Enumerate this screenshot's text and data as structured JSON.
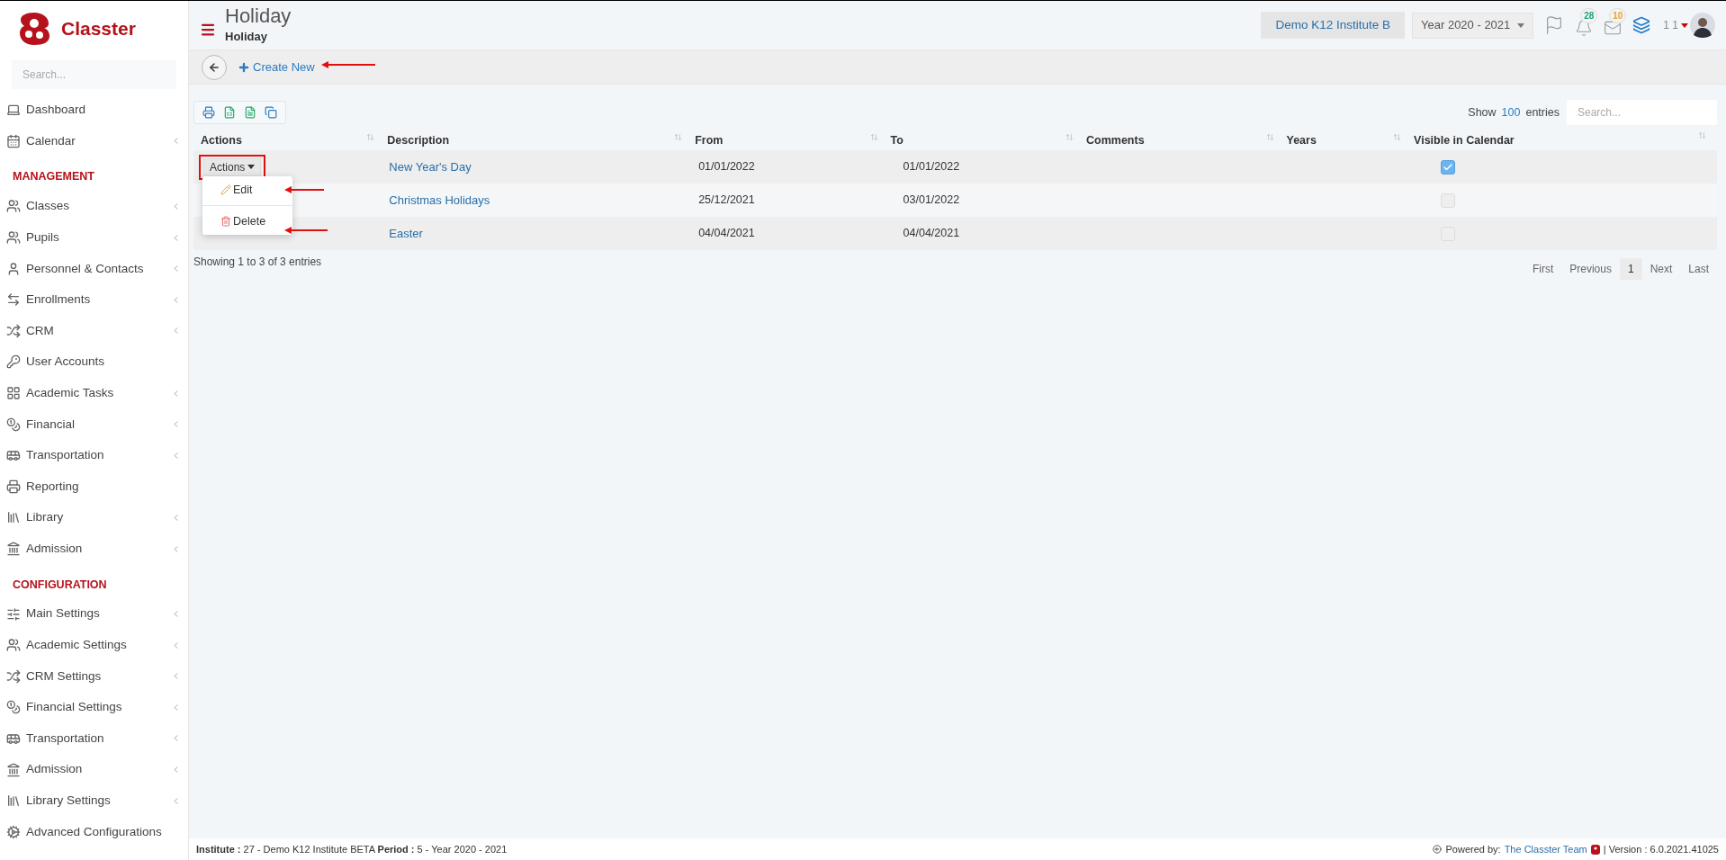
{
  "brand": {
    "name": "Classter"
  },
  "sidebar": {
    "search_placeholder": "Search...",
    "items": [
      {
        "kind": "item",
        "label": "Dashboard",
        "submenu": false
      },
      {
        "kind": "item",
        "label": "Calendar",
        "submenu": true
      },
      {
        "kind": "section",
        "label": "MANAGEMENT"
      },
      {
        "kind": "item",
        "label": "Classes",
        "submenu": true
      },
      {
        "kind": "item",
        "label": "Pupils",
        "submenu": true
      },
      {
        "kind": "item",
        "label": "Personnel & Contacts",
        "submenu": true
      },
      {
        "kind": "item",
        "label": "Enrollments",
        "submenu": true
      },
      {
        "kind": "item",
        "label": "CRM",
        "submenu": true
      },
      {
        "kind": "item",
        "label": "User Accounts",
        "submenu": false
      },
      {
        "kind": "item",
        "label": "Academic Tasks",
        "submenu": true
      },
      {
        "kind": "item",
        "label": "Financial",
        "submenu": true
      },
      {
        "kind": "item",
        "label": "Transportation",
        "submenu": true
      },
      {
        "kind": "item",
        "label": "Reporting",
        "submenu": false
      },
      {
        "kind": "item",
        "label": "Library",
        "submenu": true
      },
      {
        "kind": "item",
        "label": "Admission",
        "submenu": true
      },
      {
        "kind": "section",
        "label": "CONFIGURATION"
      },
      {
        "kind": "item",
        "label": "Main Settings",
        "submenu": true
      },
      {
        "kind": "item",
        "label": "Academic Settings",
        "submenu": true
      },
      {
        "kind": "item",
        "label": "CRM Settings",
        "submenu": true
      },
      {
        "kind": "item",
        "label": "Financial Settings",
        "submenu": true
      },
      {
        "kind": "item",
        "label": "Transportation",
        "submenu": true
      },
      {
        "kind": "item",
        "label": "Admission",
        "submenu": true
      },
      {
        "kind": "item",
        "label": "Library Settings",
        "submenu": true
      },
      {
        "kind": "item",
        "label": "Advanced Configurations",
        "submenu": false
      }
    ]
  },
  "header": {
    "title": "Holiday",
    "subtitle": "Holiday",
    "institute": "Demo K12 Institute B",
    "year": "Year 2020 - 2021",
    "notifications": "28",
    "messages": "10",
    "user": "1 1"
  },
  "toolbar": {
    "create_label": "Create New"
  },
  "table": {
    "show_label": "Show",
    "page_length": "100",
    "entries_label": "entries",
    "search_placeholder": "Search...",
    "columns": [
      "Actions",
      "Description",
      "From",
      "To",
      "Comments",
      "Years",
      "Visible in Calendar"
    ],
    "rows": [
      {
        "actions": "Actions",
        "description": "New Year's Day",
        "from": "01/01/2022",
        "to": "01/01/2022",
        "visible": true
      },
      {
        "description": "Christmas Holidays",
        "from": "25/12/2021",
        "to": "03/01/2022",
        "visible": false
      },
      {
        "description": "Easter",
        "from": "04/04/2021",
        "to": "04/04/2021",
        "visible": false
      }
    ],
    "menu": [
      "Edit",
      "Delete"
    ],
    "info": "Showing 1 to 3 of 3 entries",
    "pagination": [
      {
        "label": "First",
        "selected": false
      },
      {
        "label": "Previous",
        "selected": false
      },
      {
        "label": "1",
        "selected": true
      },
      {
        "label": "Next",
        "selected": false
      },
      {
        "label": "Last",
        "selected": false
      }
    ]
  },
  "footer": {
    "left": "**Institute :** 27 - Demo K12 Institute BETA **Period :** 5 - Year 2020 - 2021",
    "powered": "Powered by:",
    "team": "The Classter Team",
    "version": "| Version : 6.0.2021.41025"
  }
}
